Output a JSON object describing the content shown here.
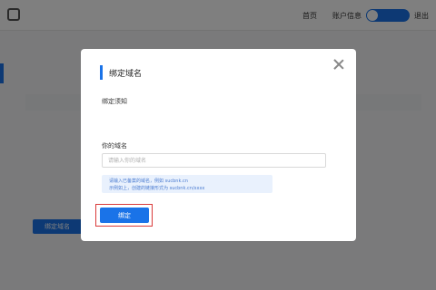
{
  "background": {
    "nav": {
      "home": "首页",
      "account": "账户信息",
      "exit": "退出"
    },
    "actions": {
      "bind_domain": "绑定域名"
    }
  },
  "modal": {
    "title": "绑定域名",
    "notice_title": "绑定须知",
    "field_label": "你的域名",
    "input_placeholder": "请输入你的域名",
    "hint_lines": [
      "请输入已备案的域名，例如 sucbnk.cn",
      "示例如上，创建的链接形式为 sucbnk.cn/xxxx"
    ],
    "submit_label": "绑定"
  },
  "colors": {
    "accent": "#1a73e8",
    "highlight": "#d93a3a",
    "hint_bg": "#e9f1fd"
  }
}
